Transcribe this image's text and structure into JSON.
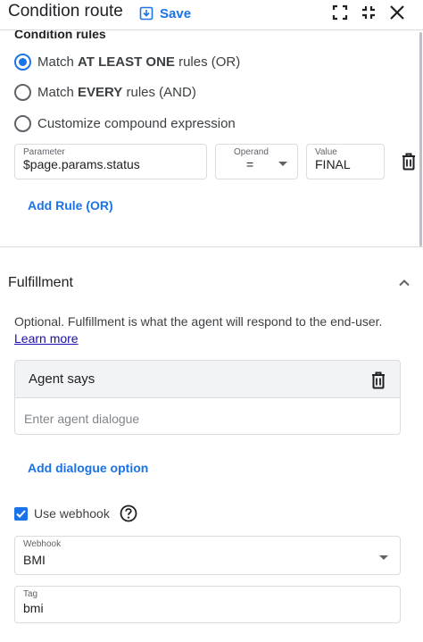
{
  "header": {
    "title": "Condition route",
    "save_label": "Save",
    "icons": [
      "save-icon",
      "fullscreen-icon",
      "collapse-icon",
      "close-icon"
    ]
  },
  "condition_rules": {
    "section_label": "Condition rules",
    "options": [
      {
        "prefix": "Match ",
        "bold": "AT LEAST ONE",
        "suffix": " rules (OR)",
        "checked": true
      },
      {
        "prefix": "Match ",
        "bold": "EVERY",
        "suffix": " rules (AND)",
        "checked": false
      },
      {
        "prefix": "Customize compound expression",
        "bold": "",
        "suffix": "",
        "checked": false
      }
    ],
    "rule": {
      "parameter_label": "Parameter",
      "parameter_value": "$page.params.status",
      "operand_label": "Operand",
      "operand_value": "=",
      "value_label": "Value",
      "value_value": "FINAL"
    },
    "add_rule_label": "Add Rule (OR)"
  },
  "fulfillment": {
    "title": "Fulfillment",
    "description": "Optional. Fulfillment is what the agent will respond to the end-user.",
    "learn_more": "Learn more",
    "agent_says_title": "Agent says",
    "agent_dialogue_placeholder": "Enter agent dialogue",
    "add_dialogue_label": "Add dialogue option",
    "use_webhook_label": "Use webhook",
    "use_webhook_checked": true,
    "webhook_label": "Webhook",
    "webhook_value": "BMI",
    "tag_label": "Tag",
    "tag_value": "bmi"
  },
  "colors": {
    "accent": "#1a73e8",
    "link": "#1a0dab",
    "border": "#dadce0",
    "text": "#202124"
  }
}
